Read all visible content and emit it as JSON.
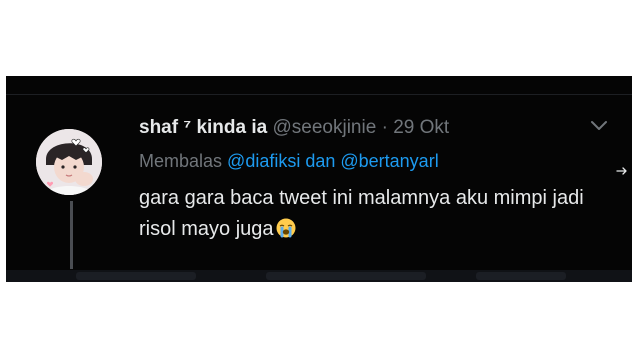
{
  "tweet": {
    "display_name": "shaf ⁷ kinda ia",
    "handle": "@seeokjinie",
    "separator": "·",
    "date": "29 Okt",
    "reply_prefix": "Membalas",
    "reply_mentions": "@diafiksi dan @bertanyarl",
    "text": "gara gara baca tweet ini malamnya aku mimpi jadi risol mayo juga"
  },
  "icons": {
    "more": "chevron-down-icon",
    "share": "arrow-right-icon",
    "emoji": "loudly-crying-face-icon"
  },
  "colors": {
    "background": "#050505",
    "primary_text": "#e7e9ea",
    "secondary_text": "#71767b",
    "mention": "#1d9bf0"
  }
}
